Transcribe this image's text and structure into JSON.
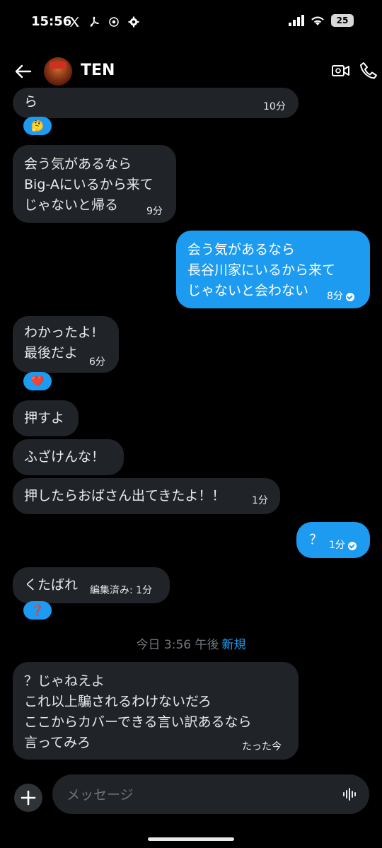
{
  "status_bar": {
    "time": "15:56",
    "battery": "25"
  },
  "header": {
    "contact_name": "TEN"
  },
  "messages": [
    {
      "text": "ら",
      "time": "10分",
      "reaction": "🤔"
    },
    {
      "text": "会う気があるなら\nBig-Aにいるから来て\nじゃないと帰る",
      "time": "9分"
    },
    {
      "text": "会う気があるなら\n長谷川家にいるから来て\nじゃないと会わない",
      "time": "8分"
    },
    {
      "text": "わかったよ!\n最後だよ",
      "time": "6分",
      "reaction": "❤️"
    },
    {
      "text": "押すよ"
    },
    {
      "text": "ふざけんな！"
    },
    {
      "text": "押したらおばさん出てきたよ！！",
      "time": "1分"
    },
    {
      "text": "？",
      "time": "1分"
    },
    {
      "text": "くたばれ",
      "time": "編集済み: 1分",
      "reaction": "❓"
    },
    {
      "text": "？じゃねえよ\nこれ以上騙されるわけないだろ\nここからカバーできる言い訳あるなら\n言ってみろ",
      "time": "たった今"
    }
  ],
  "day_label": {
    "text": "今日 3:56 午後",
    "new_tag": "新規"
  },
  "composer": {
    "placeholder": "メッセージ"
  },
  "colors": {
    "accent": "#1d9bf0",
    "incoming_bubble": "#202327",
    "background": "#000000"
  }
}
